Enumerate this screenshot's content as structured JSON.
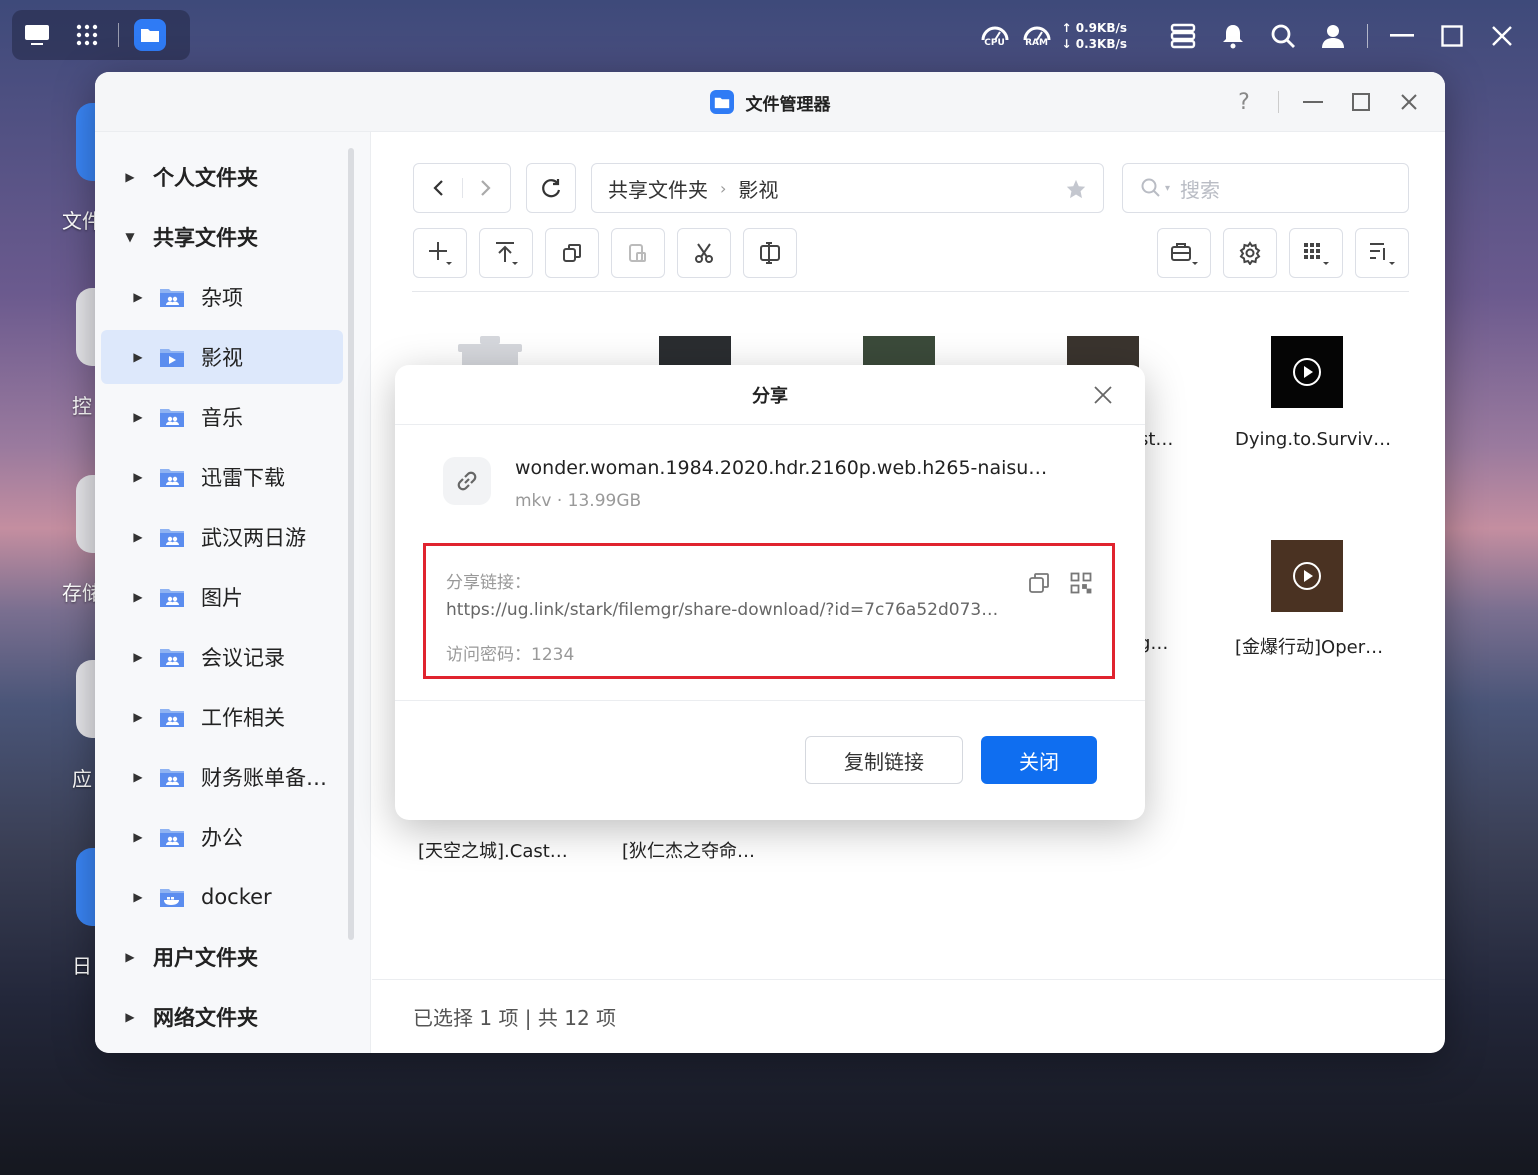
{
  "topbar": {
    "cpu_label": "CPU",
    "ram_label": "RAM",
    "upload": "↑ 0.9KB/s",
    "download": "↓ 0.3KB/s"
  },
  "desktop": {
    "labels": [
      "文件",
      "控",
      "存储",
      "应",
      "日"
    ]
  },
  "window": {
    "title": "文件管理器",
    "help": "?"
  },
  "sidebar": {
    "personal": "个人文件夹",
    "shared": "共享文件夹",
    "folders": [
      "杂项",
      "影视",
      "音乐",
      "迅雷下载",
      "武汉两日游",
      "图片",
      "会议记录",
      "工作相关",
      "财务账单备…",
      "办公",
      "docker"
    ],
    "user": "用户文件夹",
    "network": "网络文件夹"
  },
  "breadcrumb": {
    "root": "共享文件夹",
    "current": "影视"
  },
  "search": {
    "placeholder": "搜索"
  },
  "files": {
    "row1_right_a": "st…",
    "row1_right_b": "Dying.to.Surviv…",
    "row2_right_a": "g…",
    "row2_right_b": "[金爆行动]Oper…",
    "row3_a": "[天空之城].Cast…",
    "row3_b": "[狄仁杰之夺命…"
  },
  "status": {
    "text": "已选择 1 项 | 共 12 项"
  },
  "dialog": {
    "title": "分享",
    "file_name": "wonder.woman.1984.2020.hdr.2160p.web.h265-naisu…",
    "file_meta": "mkv · 13.99GB",
    "link_label": "分享链接：",
    "link_url": "https://ug.link/stark/filemgr/share-download/?id=7c76a52d073…",
    "password": "访问密码：1234",
    "copy_button": "复制链接",
    "close_button": "关闭"
  },
  "colors": {
    "accent": "#0f6ef0",
    "highlight_border": "#e0232e",
    "selected_bg": "#dde8fb"
  }
}
